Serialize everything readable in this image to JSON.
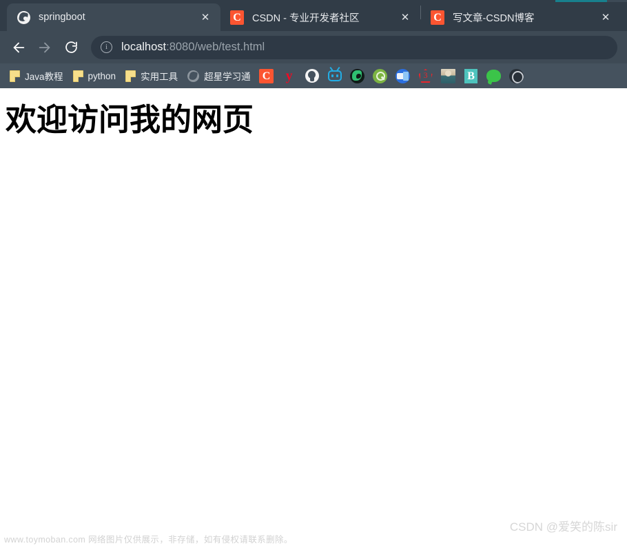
{
  "browser": {
    "tabs": [
      {
        "title": "springboot",
        "favicon": "globe-icon",
        "active": true,
        "close_label": "✕"
      },
      {
        "title": "CSDN - 专业开发者社区",
        "favicon": "csdn-icon",
        "active": false,
        "close_label": "✕"
      },
      {
        "title": "写文章-CSDN博客",
        "favicon": "csdn-icon",
        "active": false,
        "close_label": "✕"
      }
    ],
    "toolbar": {
      "back_icon": "back-arrow-icon",
      "forward_icon": "forward-arrow-icon",
      "reload_icon": "reload-icon",
      "omnibox": {
        "security_icon": "info-circle-icon",
        "security_glyph": "i",
        "host": "localhost",
        "path": ":8080/web/test.html"
      }
    },
    "bookmarks": [
      {
        "label": "Java教程",
        "icon": "folder-icon"
      },
      {
        "label": "python",
        "icon": "folder-icon"
      },
      {
        "label": "实用工具",
        "icon": "folder-icon"
      },
      {
        "label": "超星学习通",
        "icon": "globe-icon"
      }
    ],
    "bookmark_icons": [
      {
        "name": "csdn-icon",
        "glyph": "C"
      },
      {
        "name": "youdao-icon",
        "glyph": "y"
      },
      {
        "name": "github-icon",
        "glyph": ""
      },
      {
        "name": "bilibili-icon",
        "glyph": ""
      },
      {
        "name": "dark-globe-icon",
        "glyph": ""
      },
      {
        "name": "green-search-icon",
        "glyph": ""
      },
      {
        "name": "blue-tool-icon",
        "glyph": ""
      },
      {
        "name": "red-pentagon-icon",
        "glyph": "3"
      },
      {
        "name": "portrait-avatar-icon",
        "glyph": ""
      },
      {
        "name": "teal-b-icon",
        "glyph": "B"
      },
      {
        "name": "wechat-icon",
        "glyph": ""
      },
      {
        "name": "partial-icon",
        "glyph": ""
      }
    ]
  },
  "page": {
    "heading": "欢迎访问我的网页"
  },
  "watermarks": {
    "left": "www.toymoban.com 网络图片仅供展示，非存储，如有侵权请联系删除。",
    "right": "CSDN @爱笑的陈sir"
  },
  "colors": {
    "tabstrip_bg": "#313c47",
    "toolbar_bg": "#3e4a55",
    "bookmarks_bg": "#45525e",
    "omnibox_bg": "#2e3945",
    "accent_teal": "#18808d",
    "csdn_orange": "#fc5531",
    "page_bg": "#ffffff"
  }
}
